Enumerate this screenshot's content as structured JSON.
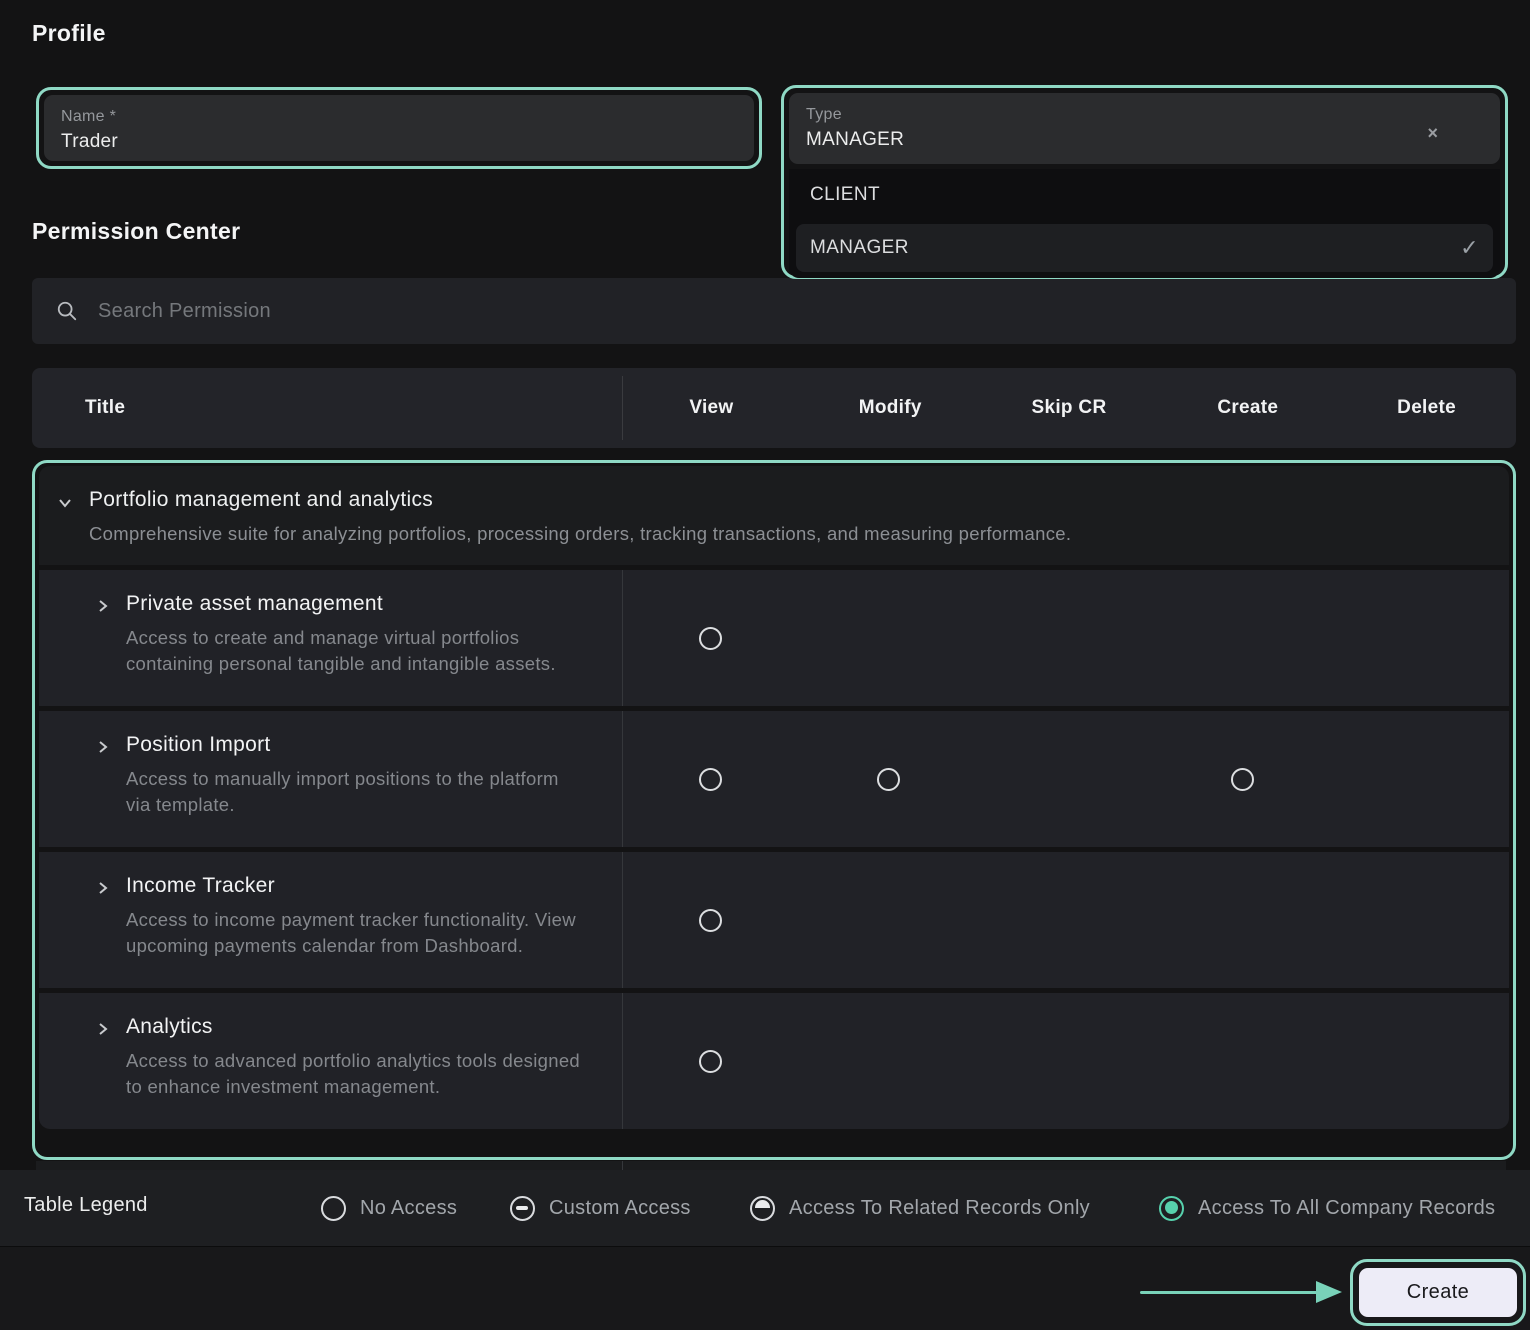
{
  "colors": {
    "accent": "#8fd9c5",
    "legend_active": "#57d1ad"
  },
  "profile": {
    "section_title": "Profile",
    "name_field": {
      "label": "Name *",
      "value": "Trader"
    },
    "type_field": {
      "label": "Type",
      "value": "MANAGER",
      "options": [
        {
          "label": "CLIENT",
          "selected": false
        },
        {
          "label": "MANAGER",
          "selected": true
        }
      ]
    }
  },
  "permission_center": {
    "section_title": "Permission Center",
    "search_placeholder": "Search Permission",
    "table": {
      "columns": [
        "Title",
        "View",
        "Modify",
        "Skip CR",
        "Create",
        "Delete"
      ],
      "group": {
        "title": "Portfolio management and analytics",
        "description": "Comprehensive suite for analyzing portfolios, processing orders, tracking transactions, and measuring performance."
      },
      "rows": [
        {
          "title": "Private asset management",
          "description": "Access to create and manage virtual portfolios containing personal tangible and intangible assets.",
          "access": {
            "view": "no-access",
            "modify": null,
            "skip_cr": null,
            "create": null,
            "delete": null
          }
        },
        {
          "title": "Position Import",
          "description": "Access to manually import positions to the platform via template.",
          "access": {
            "view": "no-access",
            "modify": "no-access",
            "skip_cr": null,
            "create": "no-access",
            "delete": null
          }
        },
        {
          "title": "Income Tracker",
          "description": "Access to income payment tracker functionality. View upcoming payments calendar from Dashboard.",
          "access": {
            "view": "no-access",
            "modify": null,
            "skip_cr": null,
            "create": null,
            "delete": null
          }
        },
        {
          "title": "Analytics",
          "description": "Access to advanced portfolio analytics tools designed to enhance investment management.",
          "access": {
            "view": "no-access",
            "modify": null,
            "skip_cr": null,
            "create": null,
            "delete": null
          }
        }
      ]
    }
  },
  "legend": {
    "label": "Table Legend",
    "items": [
      {
        "label": "No Access",
        "icon": "radio-empty"
      },
      {
        "label": "Custom Access",
        "icon": "radio-dash"
      },
      {
        "label": "Access To Related Records Only",
        "icon": "radio-half-filled"
      },
      {
        "label": "Access To All Company Records",
        "icon": "radio-filled"
      }
    ]
  },
  "footer": {
    "create_label": "Create"
  }
}
